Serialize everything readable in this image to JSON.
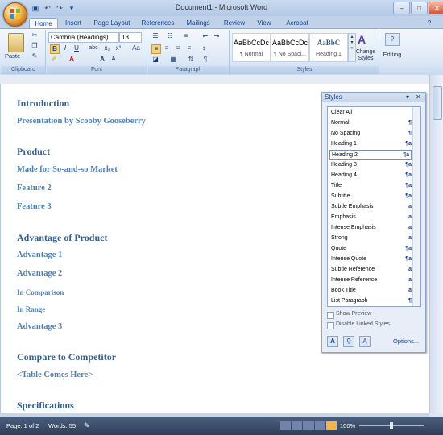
{
  "window": {
    "title": "Document1 - Microsoft Word",
    "minimize": "–",
    "maximize": "□",
    "close": "✕"
  },
  "tabs": [
    "Home",
    "Insert",
    "Page Layout",
    "References",
    "Mailings",
    "Review",
    "View",
    "Acrobat"
  ],
  "ribbon": {
    "clipboard": {
      "label": "Clipboard",
      "paste": "Paste"
    },
    "font": {
      "label": "Font",
      "font_name": "Cambria (Headings)",
      "font_size": "13",
      "bold": "B",
      "italic": "I",
      "underline": "U",
      "strike": "abc",
      "sub": "x₂",
      "sup": "x²",
      "grow": "A",
      "shrink": "A",
      "clear": "Aa"
    },
    "paragraph": {
      "label": "Paragraph"
    },
    "styles": {
      "label": "Styles",
      "items": [
        {
          "preview": "AaBbCcDc",
          "name": "¶ Normal"
        },
        {
          "preview": "AaBbCcDc",
          "name": "¶ No Spaci..."
        },
        {
          "preview": "AaBbC",
          "name": "Heading 1"
        }
      ],
      "change_styles": "Change Styles"
    },
    "editing": {
      "label": "Editing"
    }
  },
  "document": {
    "headings": [
      {
        "text": "Introduction",
        "level": 1
      },
      {
        "text": "Presentation by Scooby Gooseberry",
        "level": 2
      },
      {
        "text": "Product",
        "level": 1
      },
      {
        "text": "Made for So-and-so Market",
        "level": 2
      },
      {
        "text": "Feature 2",
        "level": 2
      },
      {
        "text": "Feature 3",
        "level": 2
      },
      {
        "text": "Advantage of Product",
        "level": 1
      },
      {
        "text": "Advantage 1",
        "level": 2
      },
      {
        "text": "Advantage 2",
        "level": 2
      },
      {
        "text": "In Comparison",
        "level": 3
      },
      {
        "text": "In Range",
        "level": 3
      },
      {
        "text": "Advantage 3",
        "level": 2
      },
      {
        "text": "Compare to Competitor",
        "level": 1
      },
      {
        "text": "<Table Comes Here>",
        "level": 2
      },
      {
        "text": "Specifications",
        "level": 1
      }
    ]
  },
  "styles_pane": {
    "title": "Styles",
    "items": [
      {
        "label": "Clear All",
        "mark": ""
      },
      {
        "label": "Normal",
        "mark": "¶"
      },
      {
        "label": "No Spacing",
        "mark": "¶"
      },
      {
        "label": "Heading 1",
        "mark": "¶a"
      },
      {
        "label": "Heading 2",
        "mark": "¶a",
        "selected": true
      },
      {
        "label": "Heading 3",
        "mark": "¶a"
      },
      {
        "label": "Heading 4",
        "mark": "¶a"
      },
      {
        "label": "Title",
        "mark": "¶a"
      },
      {
        "label": "Subtitle",
        "mark": "¶a"
      },
      {
        "label": "Subtle Emphasis",
        "mark": "a"
      },
      {
        "label": "Emphasis",
        "mark": "a"
      },
      {
        "label": "Intense Emphasis",
        "mark": "a"
      },
      {
        "label": "Strong",
        "mark": "a"
      },
      {
        "label": "Quote",
        "mark": "¶a"
      },
      {
        "label": "Intense Quote",
        "mark": "¶a"
      },
      {
        "label": "Subtle Reference",
        "mark": "a"
      },
      {
        "label": "Intense Reference",
        "mark": "a"
      },
      {
        "label": "Book Title",
        "mark": "a"
      },
      {
        "label": "List Paragraph",
        "mark": "¶"
      }
    ],
    "show_preview": "Show Preview",
    "disable_linked": "Disable Linked Styles",
    "options": "Options..."
  },
  "status": {
    "page": "Page: 1 of 2",
    "words": "Words: 55",
    "zoom": "100%"
  }
}
